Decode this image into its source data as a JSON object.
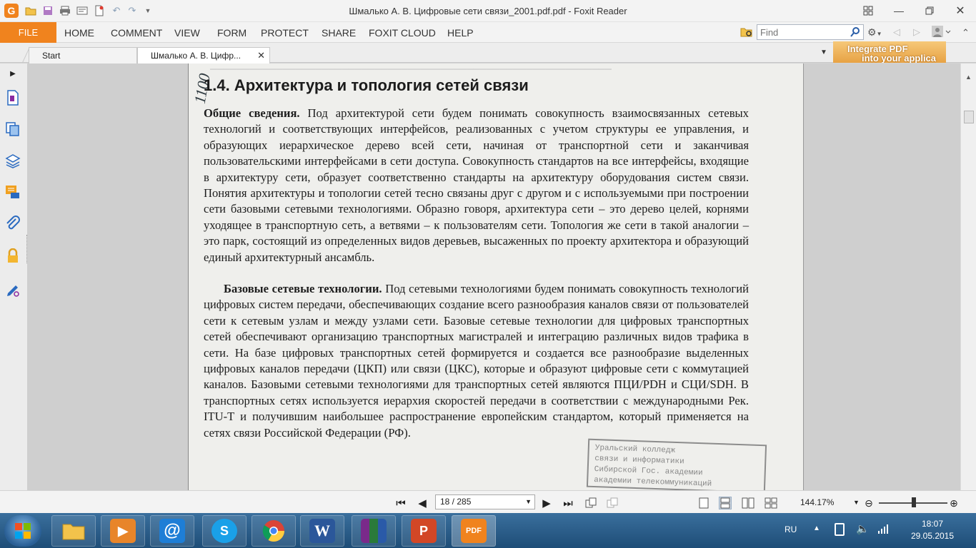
{
  "window": {
    "title": "Шмалько А. В. Цифровые сети связи_2001.pdf.pdf - Foxit Reader",
    "app_logo": "G"
  },
  "menu": {
    "file": "FILE",
    "items": [
      "HOME",
      "COMMENT",
      "VIEW",
      "FORM",
      "PROTECT",
      "SHARE",
      "FOXIT CLOUD",
      "HELP"
    ]
  },
  "search": {
    "placeholder": "Find"
  },
  "tabs": [
    {
      "label": "Start",
      "active": false
    },
    {
      "label": "Шмалько А. В. Цифр...",
      "active": true
    }
  ],
  "ad_banner": {
    "line1": "Integrate PDF",
    "line2": "into your applica"
  },
  "document": {
    "heading": "1.4.  Архитектура и топология сетей связи",
    "handwritten_note": "1100",
    "para1_lead": "Общие сведения.",
    "para1_body": " Под архитектурой сети будем понимать совокупность взаимосвязанных сетевых технологий и соответствующих интерфейсов, реализованных с учетом структуры ее управления, и образующих иерархическое дерево всей сети, начиная от транспортной сети и заканчивая пользовательскими интерфейсами в сети доступа. Совокупность стандартов на все интерфейсы, входящие в архитектуру сети, образует соответственно стандарты на архитектуру оборудования систем связи. Понятия архитектуры и топологии сетей тесно связаны друг с другом и с используемыми при построении сети базовыми сетевыми технологиями. Образно говоря, архитектура сети – это дерево целей, корнями уходящее в транспортную сеть, а ветвями – к пользователям сети. Топология же сети в такой аналогии – это парк, состоящий из определенных видов деревьев, высаженных по проекту архитектора и образующий единый архитектурный ансамбль.",
    "para2_lead": "Базовые сетевые технологии.",
    "para2_body": " Под сетевыми технологиями будем понимать совокупность технологий цифровых систем передачи, обеспечивающих создание всего разнообразия каналов связи от пользователей сети к сетевым узлам и между узлами сети. Базовые сетевые технологии для цифровых транспортных сетей обеспечивают организацию транспортных магистралей и интеграцию различных видов трафика в сети. На базе цифровых транспортных сетей формируется и создается все разнообразие выделенных цифровых каналов передачи (ЦКП) или связи (ЦКС), которые и образуют цифровые сети с коммутацией каналов. Базовыми сетевыми технологиями для транспортных сетей являются ПЦИ/PDH и СЦИ/SDH. В транспортных сетях используется иерархия скоростей передачи в соответствии с международными Рек. ITU-T и получившим наибольшее распространение европейским стандартом, который применяется на сетях связи Российской Федерации (РФ).",
    "stamp_lines": [
      "Уральский колледж",
      "связи и информатики",
      "Сибирской Гос. академии",
      "академии телекоммуникаций"
    ]
  },
  "status": {
    "page_field": "18 / 285",
    "zoom": "144.17%"
  },
  "taskbar": {
    "apps": [
      "explorer",
      "media-player",
      "mail",
      "skype",
      "chrome",
      "word",
      "winrar",
      "powerpoint",
      "foxit-pdf"
    ],
    "word_label": "W",
    "pdf_label": "PDF",
    "lang": "RU",
    "time": "18:07",
    "date": "29.05.2015"
  }
}
